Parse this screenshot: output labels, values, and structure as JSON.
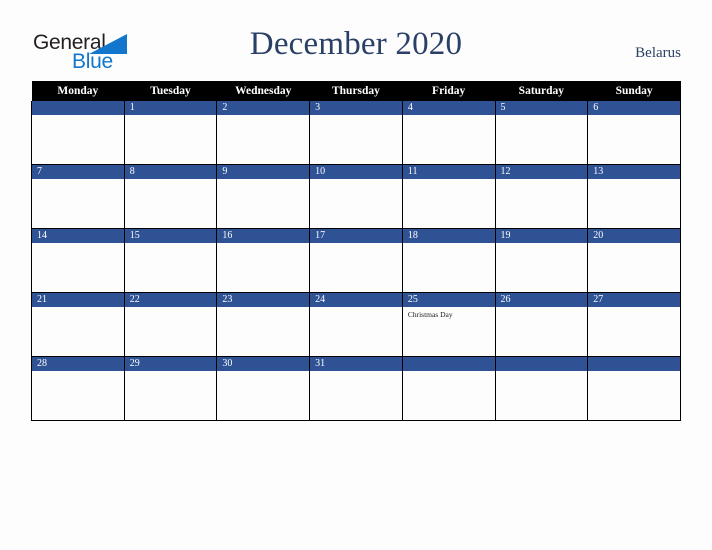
{
  "logo": {
    "text_primary": "General",
    "text_secondary": "Blue",
    "triangle_icon": "blue-triangle-icon",
    "primary_color": "#231f20",
    "secondary_color": "#1277cc"
  },
  "header": {
    "title": "December 2020",
    "country": "Belarus",
    "title_color": "#2b4066"
  },
  "calendar": {
    "weekday_headers": [
      "Monday",
      "Tuesday",
      "Wednesday",
      "Thursday",
      "Friday",
      "Saturday",
      "Sunday"
    ],
    "header_background": "#000000",
    "day_bar_color": "#2e5293",
    "weeks": [
      [
        {
          "day": "",
          "event": ""
        },
        {
          "day": "1",
          "event": ""
        },
        {
          "day": "2",
          "event": ""
        },
        {
          "day": "3",
          "event": ""
        },
        {
          "day": "4",
          "event": ""
        },
        {
          "day": "5",
          "event": ""
        },
        {
          "day": "6",
          "event": ""
        }
      ],
      [
        {
          "day": "7",
          "event": ""
        },
        {
          "day": "8",
          "event": ""
        },
        {
          "day": "9",
          "event": ""
        },
        {
          "day": "10",
          "event": ""
        },
        {
          "day": "11",
          "event": ""
        },
        {
          "day": "12",
          "event": ""
        },
        {
          "day": "13",
          "event": ""
        }
      ],
      [
        {
          "day": "14",
          "event": ""
        },
        {
          "day": "15",
          "event": ""
        },
        {
          "day": "16",
          "event": ""
        },
        {
          "day": "17",
          "event": ""
        },
        {
          "day": "18",
          "event": ""
        },
        {
          "day": "19",
          "event": ""
        },
        {
          "day": "20",
          "event": ""
        }
      ],
      [
        {
          "day": "21",
          "event": ""
        },
        {
          "day": "22",
          "event": ""
        },
        {
          "day": "23",
          "event": ""
        },
        {
          "day": "24",
          "event": ""
        },
        {
          "day": "25",
          "event": "Christmas Day"
        },
        {
          "day": "26",
          "event": ""
        },
        {
          "day": "27",
          "event": ""
        }
      ],
      [
        {
          "day": "28",
          "event": ""
        },
        {
          "day": "29",
          "event": ""
        },
        {
          "day": "30",
          "event": ""
        },
        {
          "day": "31",
          "event": ""
        },
        {
          "day": "",
          "event": ""
        },
        {
          "day": "",
          "event": ""
        },
        {
          "day": "",
          "event": ""
        }
      ]
    ]
  }
}
